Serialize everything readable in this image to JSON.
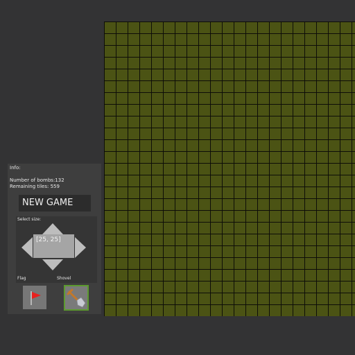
{
  "board": {
    "rows": 25,
    "cols": 25,
    "visible_rows": 25,
    "visible_cols": 22,
    "tile_color": "#4b5314",
    "line_color": "#0d0d08"
  },
  "info": {
    "header": "Info:",
    "bombs_text": "Number of bombs:132",
    "remaining_text": "Remaining tiles: 559"
  },
  "controls": {
    "new_game_label": "NEW GAME",
    "select_size_label": "Select size:",
    "size_value": "[25, 25]",
    "flag_label": "Flag",
    "shovel_label": "Shovel",
    "active_tool": "shovel",
    "active_color": "#5c9a2e"
  },
  "icons": {
    "flag": "red-flag-icon",
    "shovel": "shovel-icon"
  }
}
